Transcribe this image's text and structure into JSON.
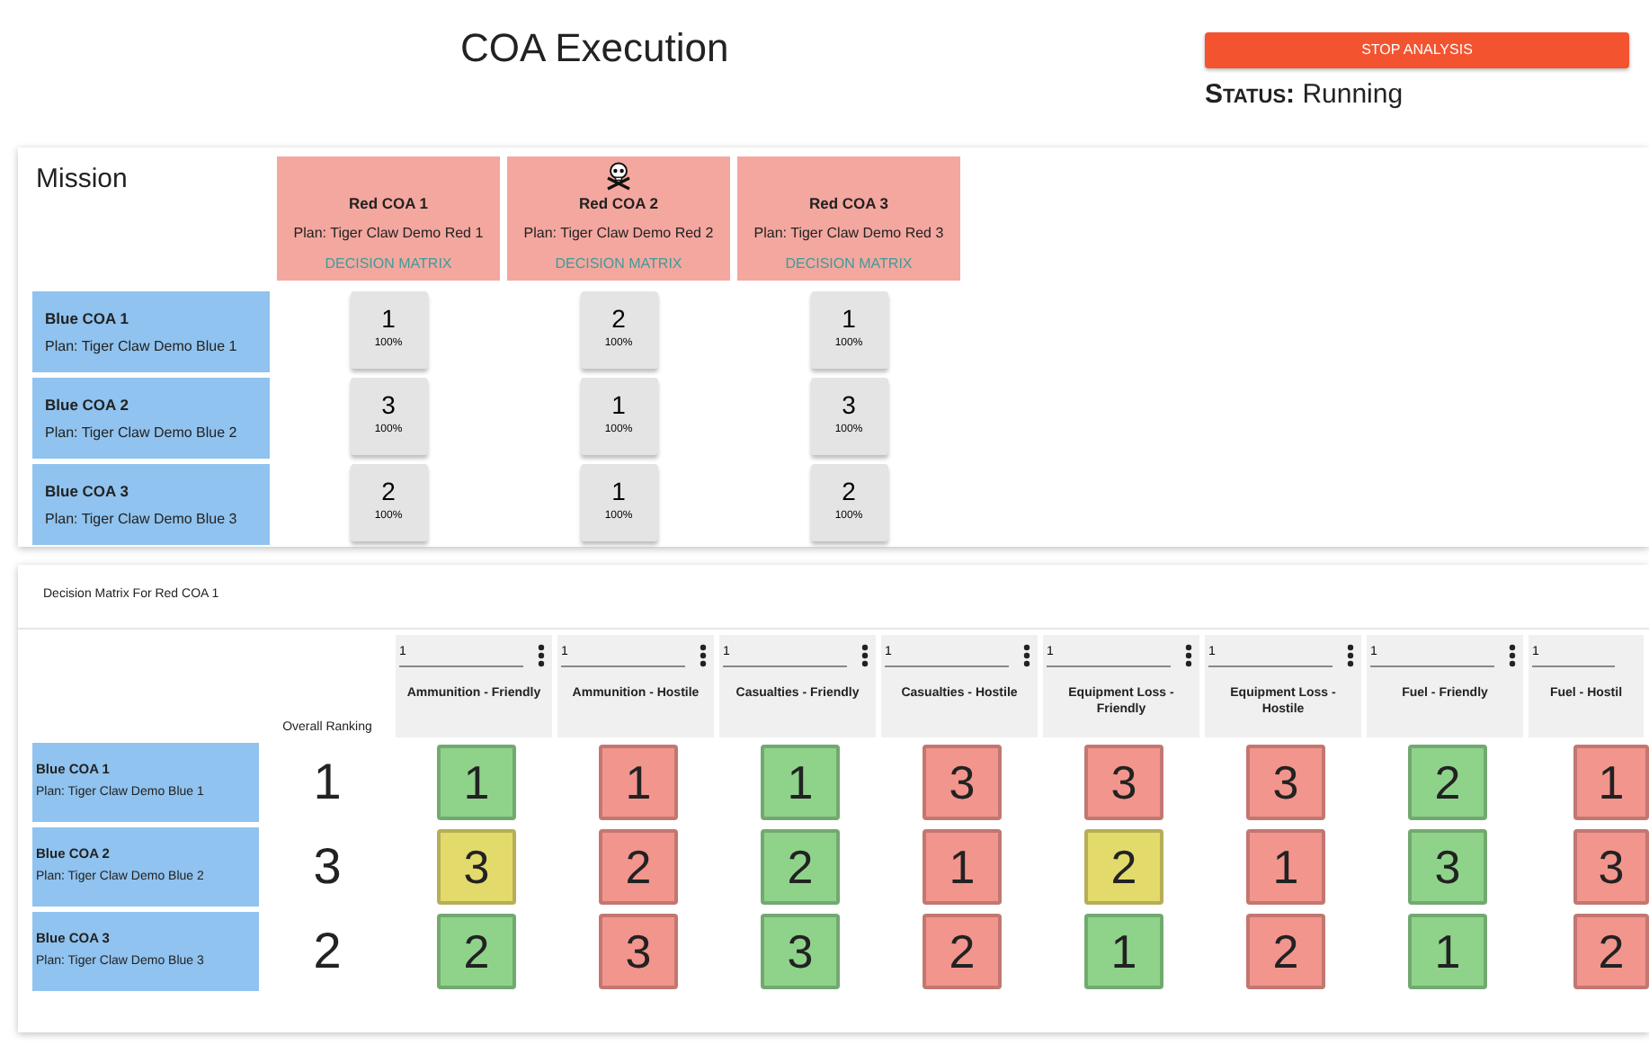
{
  "header": {
    "title": "COA Execution",
    "stop_button": "STOP ANALYSIS",
    "status_label": "Status:",
    "status_value": "Running"
  },
  "mission": {
    "title": "Mission",
    "red_coas": [
      {
        "name": "Red COA 1",
        "plan": "Plan: Tiger Claw Demo Red 1",
        "link": "DECISION MATRIX",
        "flagged": false
      },
      {
        "name": "Red COA 2",
        "plan": "Plan: Tiger Claw Demo Red 2",
        "link": "DECISION MATRIX",
        "flagged": true
      },
      {
        "name": "Red COA 3",
        "plan": "Plan: Tiger Claw Demo Red 3",
        "link": "DECISION MATRIX",
        "flagged": false
      }
    ],
    "blue_coas": [
      {
        "name": "Blue COA 1",
        "plan": "Plan: Tiger Claw Demo Blue 1",
        "scores": [
          {
            "rank": "1",
            "percent": "100%"
          },
          {
            "rank": "2",
            "percent": "100%"
          },
          {
            "rank": "1",
            "percent": "100%"
          }
        ]
      },
      {
        "name": "Blue COA 2",
        "plan": "Plan: Tiger Claw Demo Blue 2",
        "scores": [
          {
            "rank": "3",
            "percent": "100%"
          },
          {
            "rank": "1",
            "percent": "100%"
          },
          {
            "rank": "3",
            "percent": "100%"
          }
        ]
      },
      {
        "name": "Blue COA 3",
        "plan": "Plan: Tiger Claw Demo Blue 3",
        "scores": [
          {
            "rank": "2",
            "percent": "100%"
          },
          {
            "rank": "1",
            "percent": "100%"
          },
          {
            "rank": "2",
            "percent": "100%"
          }
        ]
      }
    ]
  },
  "decision_matrix": {
    "title": "Decision Matrix For Red COA 1",
    "overall_label": "Overall Ranking",
    "columns": [
      {
        "weight": "1",
        "label": "Ammunition - Friendly",
        "menu": true
      },
      {
        "weight": "1",
        "label": "Ammunition - Hostile",
        "menu": true
      },
      {
        "weight": "1",
        "label": "Casualties - Friendly",
        "menu": true
      },
      {
        "weight": "1",
        "label": "Casualties - Hostile",
        "menu": true
      },
      {
        "weight": "1",
        "label": "Equipment Loss - Friendly",
        "menu": true
      },
      {
        "weight": "1",
        "label": "Equipment Loss - Hostile",
        "menu": true
      },
      {
        "weight": "1",
        "label": "Fuel - Friendly",
        "menu": true
      },
      {
        "weight": "1",
        "label": "Fuel - Hostil",
        "menu": false
      }
    ],
    "rows": [
      {
        "name": "Blue COA 1",
        "plan": "Plan: Tiger Claw Demo Blue 1",
        "overall": "1",
        "cells": [
          {
            "value": "1",
            "color": "#8fd38b"
          },
          {
            "value": "1",
            "color": "#f2958d"
          },
          {
            "value": "1",
            "color": "#8fd38b"
          },
          {
            "value": "3",
            "color": "#f2958d"
          },
          {
            "value": "3",
            "color": "#f2958d"
          },
          {
            "value": "3",
            "color": "#f2958d"
          },
          {
            "value": "2",
            "color": "#8fd38b"
          },
          {
            "value": "1",
            "color": "#f2958d"
          }
        ]
      },
      {
        "name": "Blue COA 2",
        "plan": "Plan: Tiger Claw Demo Blue 2",
        "overall": "3",
        "cells": [
          {
            "value": "3",
            "color": "#e3da6c"
          },
          {
            "value": "2",
            "color": "#f2958d"
          },
          {
            "value": "2",
            "color": "#8fd38b"
          },
          {
            "value": "1",
            "color": "#f2958d"
          },
          {
            "value": "2",
            "color": "#e3da6c"
          },
          {
            "value": "1",
            "color": "#f2958d"
          },
          {
            "value": "3",
            "color": "#8fd38b"
          },
          {
            "value": "3",
            "color": "#f2958d"
          }
        ]
      },
      {
        "name": "Blue COA 3",
        "plan": "Plan: Tiger Claw Demo Blue 3",
        "overall": "2",
        "cells": [
          {
            "value": "2",
            "color": "#8fd38b"
          },
          {
            "value": "3",
            "color": "#f2958d"
          },
          {
            "value": "3",
            "color": "#8fd38b"
          },
          {
            "value": "2",
            "color": "#f2958d"
          },
          {
            "value": "1",
            "color": "#8fd38b"
          },
          {
            "value": "2",
            "color": "#f2958d"
          },
          {
            "value": "1",
            "color": "#8fd38b"
          },
          {
            "value": "2",
            "color": "#f2958d"
          }
        ]
      }
    ]
  }
}
